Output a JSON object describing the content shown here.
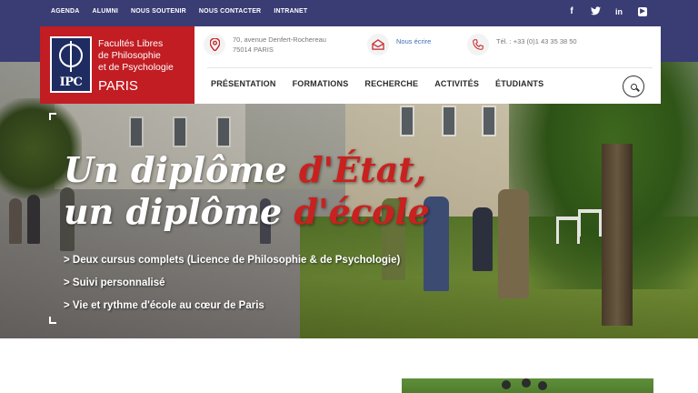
{
  "topbar": {
    "links": [
      "AGENDA",
      "ALUMNI",
      "NOUS SOUTENIR",
      "NOUS CONTACTER",
      "INTRANET"
    ],
    "social": [
      {
        "icon": "facebook-icon",
        "glyph": "f"
      },
      {
        "icon": "twitter-icon",
        "glyph": "🐦"
      },
      {
        "icon": "linkedin-icon",
        "glyph": "in"
      },
      {
        "icon": "youtube-icon",
        "glyph": "▶"
      }
    ]
  },
  "logo": {
    "emblem_text": "IPC",
    "line1": "Facultés Libres",
    "line2": "de Philosophie",
    "line3": "et de Psychologie",
    "city": "PARIS",
    "color": "#c11d23"
  },
  "contact": {
    "address_line1": "70, avenue Denfert-Rochereau",
    "address_line2": "75014 PARIS",
    "email_label": "Nous écrire",
    "phone": "Tél. : +33 (0)1 43 35 38 50"
  },
  "nav": {
    "items": [
      "PRÉSENTATION",
      "FORMATIONS",
      "RECHERCHE",
      "ACTIVITÉS",
      "ÉTUDIANTS"
    ]
  },
  "hero": {
    "headline_1a": "Un diplôme ",
    "headline_1b": "d'État,",
    "headline_2a": "un diplôme ",
    "headline_2b": "d'école",
    "bullets": [
      "> Deux cursus complets (Licence de Philosophie & de Psychologie)",
      "> Suivi personnalisé",
      "> Vie et rythme d'école au cœur de Paris"
    ],
    "accent_color": "#c8211f"
  },
  "colors": {
    "topbar": "#3a3c74",
    "link": "#3f6fb6"
  }
}
